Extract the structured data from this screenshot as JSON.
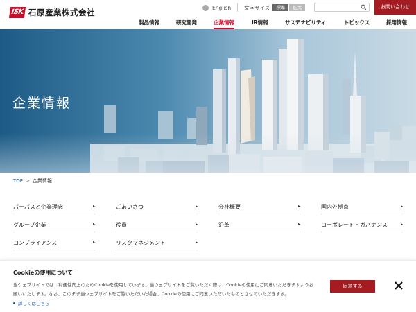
{
  "header": {
    "logo_mark": "ISK",
    "logo_text": "石原産業株式会社",
    "language_link": "English",
    "font_size_label": "文字サイズ",
    "font_size_options": [
      "標準",
      "拡大"
    ],
    "search_placeholder": "",
    "contact_label": "お問い合わせ",
    "nav": [
      {
        "label": "製品情報",
        "active": false
      },
      {
        "label": "研究開発",
        "active": false
      },
      {
        "label": "企業情報",
        "active": true
      },
      {
        "label": "IR情報",
        "active": false
      },
      {
        "label": "サステナビリティ",
        "active": false
      },
      {
        "label": "トピックス",
        "active": false
      },
      {
        "label": "採用情報",
        "active": false
      }
    ]
  },
  "hero": {
    "title": "企業情報"
  },
  "breadcrumb": {
    "top": "TOP",
    "separator": ">",
    "current": "企業情報"
  },
  "links": [
    {
      "label": "パーパスと企業理念",
      "arrow": "▸"
    },
    {
      "label": "ごあいさつ",
      "arrow": "▸"
    },
    {
      "label": "会社概要",
      "arrow": "▸"
    },
    {
      "label": "国内外拠点",
      "arrow": "▸"
    },
    {
      "label": "グループ企業",
      "arrow": "▸"
    },
    {
      "label": "役員",
      "arrow": "▸"
    },
    {
      "label": "沿革",
      "arrow": "▸"
    },
    {
      "label": "コーポレート・ガバナンス",
      "arrow": "▸"
    },
    {
      "label": "コンプライアンス",
      "arrow": "▸"
    },
    {
      "label": "リスクマネジメント",
      "arrow": "▸"
    }
  ],
  "cookie": {
    "title": "Cookieの使用について",
    "line1": "当ウェブサイトでは、利便性向上のためCookieを使用しています。当ウェブサイトをご覧いただく際は、Cookieの使用にご同意いただきますようお",
    "line2": "願いいたします。なお、このまま当ウェブサイトをご覧いただいた場合、Cookieの使用にご同意いただいたものとさせていただきます。",
    "more_link": "詳しくはこちら",
    "agree_label": "同意する"
  },
  "colors": {
    "brand_red": "#c8102e",
    "button_red": "#a51b22",
    "link_blue": "#1a5aa0"
  },
  "icons": {
    "language": "globe-icon",
    "search": "search-icon",
    "close": "close-icon",
    "link_arrow": "arrow-right-icon"
  }
}
